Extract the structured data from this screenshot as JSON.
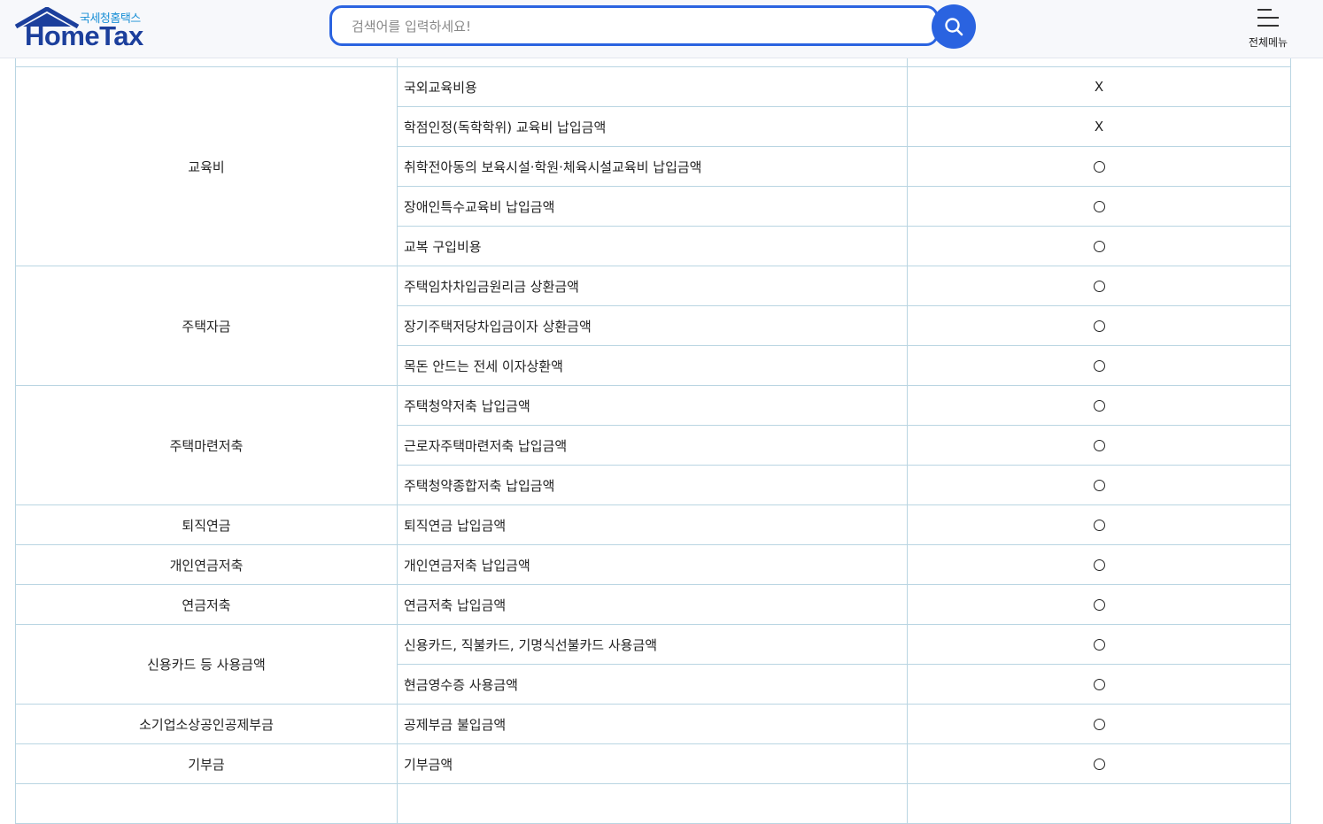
{
  "header": {
    "logo_sub": "국세청홈택스",
    "logo_main": "HomeTax",
    "search_placeholder": "검색어를 입력하세요!",
    "menu_label": "전체메뉴"
  },
  "table": {
    "groups": [
      {
        "category": "교육비",
        "items": [
          {
            "name": "국외교육비용",
            "mark": "X"
          },
          {
            "name": "학점인정(독학학위) 교육비 납입금액",
            "mark": "X"
          },
          {
            "name": "취학전아동의 보육시설·학원·체육시설교육비 납입금액",
            "mark": "O"
          },
          {
            "name": "장애인특수교육비 납입금액",
            "mark": "O"
          },
          {
            "name": "교복 구입비용",
            "mark": "O"
          }
        ]
      },
      {
        "category": "주택자금",
        "items": [
          {
            "name": "주택임차차입금원리금 상환금액",
            "mark": "O"
          },
          {
            "name": "장기주택저당차입금이자 상환금액",
            "mark": "O"
          },
          {
            "name": "목돈 안드는 전세 이자상환액",
            "mark": "O"
          }
        ]
      },
      {
        "category": "주택마련저축",
        "items": [
          {
            "name": "주택청약저축 납입금액",
            "mark": "O"
          },
          {
            "name": "근로자주택마련저축 납입금액",
            "mark": "O"
          },
          {
            "name": "주택청약종합저축 납입금액",
            "mark": "O"
          }
        ]
      },
      {
        "category": "퇴직연금",
        "items": [
          {
            "name": "퇴직연금 납입금액",
            "mark": "O"
          }
        ]
      },
      {
        "category": "개인연금저축",
        "items": [
          {
            "name": "개인연금저축 납입금액",
            "mark": "O"
          }
        ]
      },
      {
        "category": "연금저축",
        "items": [
          {
            "name": "연금저축 납입금액",
            "mark": "O"
          }
        ]
      },
      {
        "category": "신용카드 등 사용금액",
        "items": [
          {
            "name": "신용카드, 직불카드, 기명식선불카드 사용금액",
            "mark": "O"
          },
          {
            "name": "현금영수증 사용금액",
            "mark": "O"
          }
        ]
      },
      {
        "category": "소기업소상공인공제부금",
        "items": [
          {
            "name": "공제부금 불입금액",
            "mark": "O"
          }
        ]
      },
      {
        "category": "기부금",
        "items": [
          {
            "name": "기부금액",
            "mark": "O"
          }
        ]
      }
    ]
  }
}
